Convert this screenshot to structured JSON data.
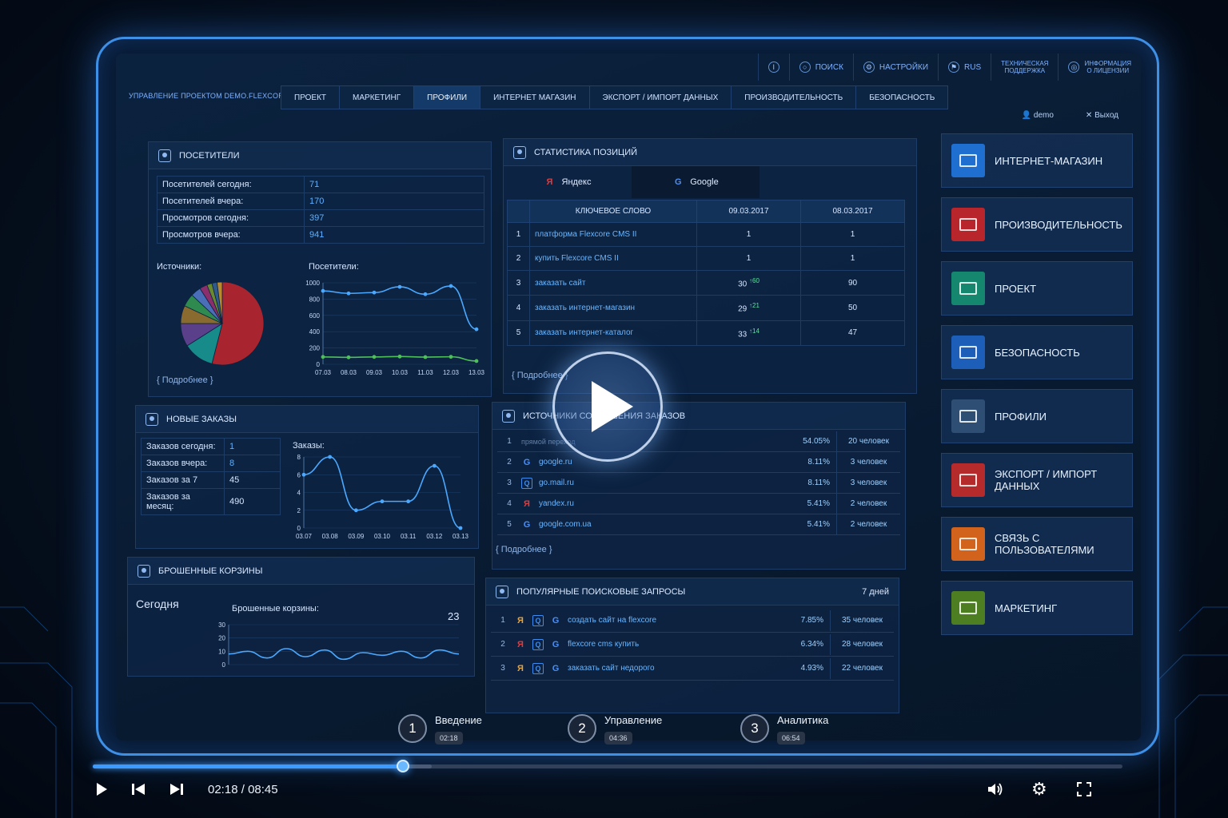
{
  "topbar": {
    "search": "Поиск",
    "settings": "Настройки",
    "lang": "RUS",
    "support_l1": "Техническая",
    "support_l2": "поддержка",
    "license_l1": "Информация",
    "license_l2": "о лицензии"
  },
  "brand": "Управление проектом DEMO.FLEXCORE.RU",
  "nav": [
    "Проект",
    "Маркетинг",
    "Профили",
    "Интернет магазин",
    "Экспорт / импорт данных",
    "Производительность",
    "Безопасность"
  ],
  "user": {
    "name": "demo",
    "logout": "Выход"
  },
  "visitors": {
    "title": "Посетители",
    "rows": [
      [
        "Посетителей сегодня:",
        "71"
      ],
      [
        "Посетителей вчера:",
        "170"
      ],
      [
        "Просмотров сегодня:",
        "397"
      ],
      [
        "Просмотров вчера:",
        "941"
      ]
    ],
    "sources_label": "Источники:",
    "chart_label": "Посетители:",
    "more": "{ Подробнее }"
  },
  "orders": {
    "title": "Новые заказы",
    "rows": [
      [
        "Заказов сегодня:",
        "1"
      ],
      [
        "Заказов вчера:",
        "8"
      ],
      [
        "Заказов за 7",
        "45"
      ],
      [
        "Заказов за месяц:",
        "490"
      ]
    ],
    "chart_label": "Заказы:"
  },
  "carts": {
    "title": "Брошенные корзины",
    "today": "Сегодня",
    "chart_label": "Брошенные корзины:",
    "count": "23"
  },
  "positions": {
    "title": "Статистика позиций",
    "tab_yandex": "Яндекс",
    "tab_google": "Google",
    "headers": [
      "Ключевое слово",
      "09.03.2017",
      "08.03.2017"
    ],
    "rows": [
      [
        "1",
        "платформа Flexcore CMS II",
        "1",
        "",
        "1"
      ],
      [
        "2",
        "купить Flexcore CMS II",
        "1",
        "",
        "1"
      ],
      [
        "3",
        "заказать сайт",
        "30",
        "↑60",
        "90"
      ],
      [
        "4",
        "заказать интернет-магазин",
        "29",
        "↑21",
        "50"
      ],
      [
        "5",
        "заказать интернет-каталог",
        "33",
        "↑14",
        "47"
      ]
    ],
    "more": "{ Подробнее }"
  },
  "sources": {
    "title": "Источники совершения заказов",
    "rows": [
      [
        "1",
        "",
        "прямой переход",
        "54.05%",
        "20 человек"
      ],
      [
        "2",
        "G",
        "google.ru",
        "8.11%",
        "3 человек"
      ],
      [
        "3",
        "Q",
        "go.mail.ru",
        "8.11%",
        "3 человек"
      ],
      [
        "4",
        "Я",
        "yandex.ru",
        "5.41%",
        "2 человек"
      ],
      [
        "5",
        "G",
        "google.com.ua",
        "5.41%",
        "2 человек"
      ]
    ],
    "more": "{ Подробнее }"
  },
  "queries": {
    "title": "Популярные поисковые запросы",
    "period": "7 дней",
    "rows": [
      [
        "1",
        "создать сайт на flexcore",
        "",
        ""
      ],
      [
        "2",
        "flexcore cms купить",
        "7.85%",
        "35 человек"
      ],
      [
        "3",
        "заказать сайт недорого",
        "6.34%",
        "28 человек"
      ]
    ],
    "extra": [
      "4.93%",
      "22 человек"
    ]
  },
  "tiles": [
    {
      "label": "Интернет-магазин",
      "color": "#1f6fd0"
    },
    {
      "label": "Производительность",
      "color": "#b8262b"
    },
    {
      "label": "Проект",
      "color": "#15876f"
    },
    {
      "label": "Безопасность",
      "color": "#1d5fb8"
    },
    {
      "label": "Профили",
      "color": "#2e4f73"
    },
    {
      "label": "Экспорт / импорт данных",
      "color": "#b52a2a"
    },
    {
      "label": "Связь с пользователями",
      "color": "#d1631c"
    },
    {
      "label": "Маркетинг",
      "color": "#4d7f22"
    }
  ],
  "chapters": [
    {
      "n": "1",
      "title": "Введение",
      "dur": "02:18"
    },
    {
      "n": "2",
      "title": "Управление",
      "dur": "04:36"
    },
    {
      "n": "3",
      "title": "Аналитика",
      "dur": "06:54"
    }
  ],
  "player": {
    "current": "02:18",
    "sep": "/",
    "total": "08:45",
    "progress": 0.301
  },
  "chart_data": [
    {
      "type": "pie",
      "title": "Источники:",
      "values": [
        54,
        12,
        9,
        7,
        5,
        4,
        3,
        2,
        2,
        2
      ],
      "colors": [
        "#a8252f",
        "#178a8a",
        "#5a3f8a",
        "#8a6b2f",
        "#2f8a4f",
        "#4a6fb8",
        "#8a2f6b",
        "#6b8a2f",
        "#2f5a8a",
        "#b88a2f"
      ]
    },
    {
      "type": "line",
      "title": "Посетители:",
      "categories": [
        "07.03",
        "08.03",
        "09.03",
        "10.03",
        "11.03",
        "12.03",
        "13.03"
      ],
      "series": [
        {
          "values": [
            900,
            870,
            880,
            950,
            860,
            960,
            430
          ],
          "color": "#4aa8ff"
        },
        {
          "values": [
            90,
            85,
            90,
            95,
            88,
            92,
            40
          ],
          "color": "#4fbf5a"
        }
      ],
      "ylim": [
        0,
        1000
      ],
      "yticks": [
        0,
        200,
        400,
        600,
        800,
        1000
      ]
    },
    {
      "type": "line",
      "title": "Заказы:",
      "categories": [
        "03.07",
        "03.08",
        "03.09",
        "03.10",
        "03.11",
        "03.12",
        "03.13"
      ],
      "series": [
        {
          "values": [
            6,
            8,
            2,
            3,
            3,
            7,
            0
          ],
          "color": "#4aa8ff"
        }
      ],
      "ylim": [
        0,
        8
      ],
      "yticks": [
        0,
        2,
        4,
        6,
        8
      ]
    },
    {
      "type": "line",
      "title": "Брошенные корзины:",
      "yticks": [
        0,
        10,
        20,
        30
      ],
      "ylim": [
        0,
        30
      ],
      "series": [
        {
          "values": [
            8,
            10,
            5,
            12,
            6,
            11,
            4,
            9,
            7,
            10,
            5,
            11,
            8
          ],
          "color": "#4aa8ff"
        }
      ]
    }
  ]
}
